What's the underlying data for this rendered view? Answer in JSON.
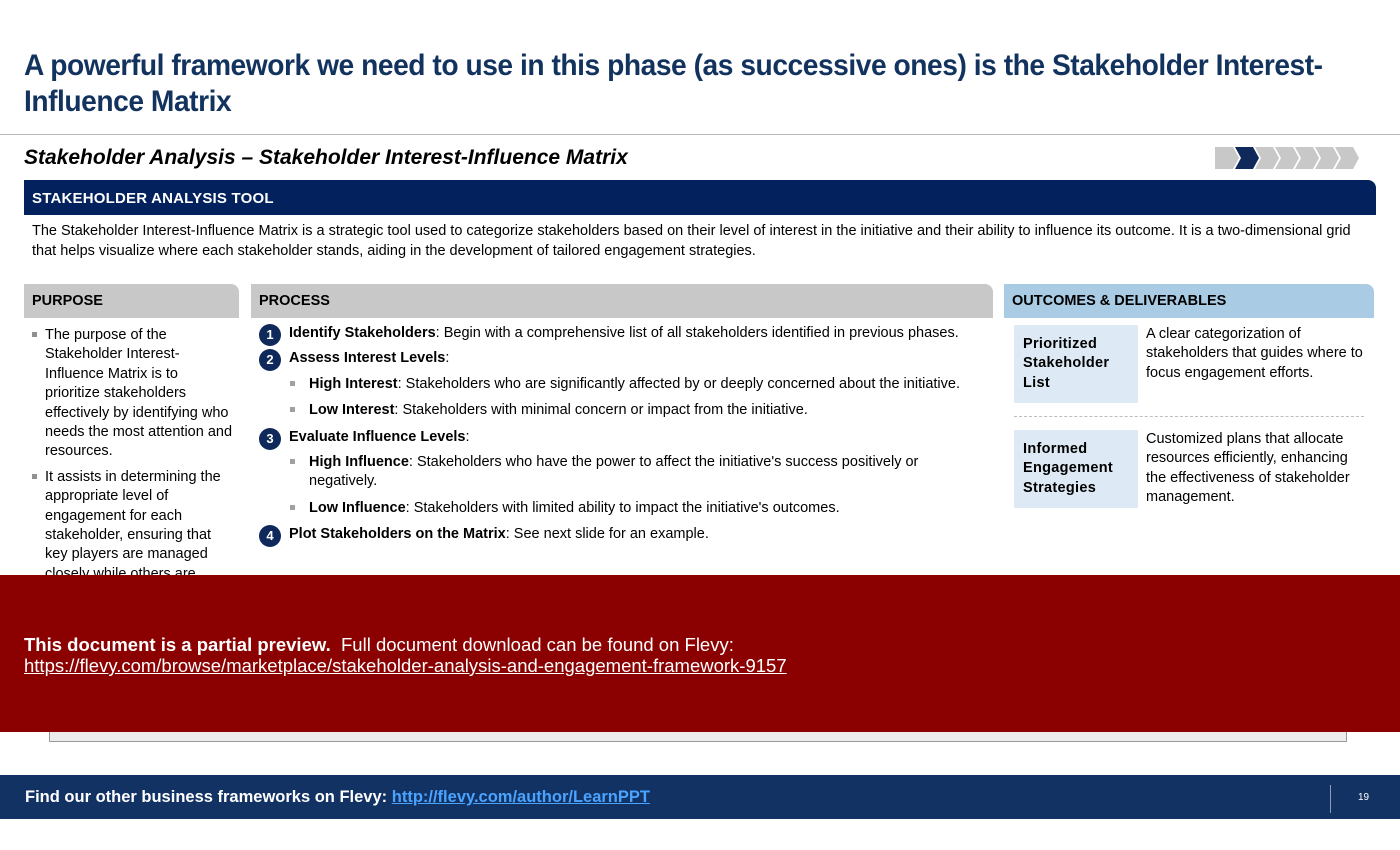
{
  "slide": {
    "title": "A powerful framework we need to use in this phase (as successive ones) is the Stakeholder Interest-Influence Matrix",
    "subtitle": "Stakeholder Analysis – Stakeholder Interest-Influence Matrix",
    "progress": {
      "total_steps": 7,
      "active_step": 2
    }
  },
  "tool": {
    "header": "STAKEHOLDER ANALYSIS TOOL",
    "description": "The Stakeholder Interest-Influence Matrix is a strategic tool used to categorize stakeholders based on their level of interest in the initiative and their ability to influence its outcome. It is a two-dimensional grid that helps visualize where each stakeholder stands, aiding in the development of tailored engagement strategies."
  },
  "purpose": {
    "header": "PURPOSE",
    "items": [
      "The purpose of the Stakeholder Interest-Influence Matrix is to prioritize stakeholders effectively by identifying who needs the most attention and resources.",
      "It assists in determining the appropriate level of engagement for each stakeholder, ensuring that key players are managed closely while others are"
    ]
  },
  "process": {
    "header": "PROCESS",
    "steps": [
      {
        "num": "1",
        "title": "Identify Stakeholders",
        "text": ": Begin with a comprehensive list of all stakeholders identified in previous phases.",
        "subs": []
      },
      {
        "num": "2",
        "title": "Assess Interest Levels",
        "text": ":",
        "subs": [
          {
            "title": "High Interest",
            "text": ": Stakeholders who are significantly affected by or deeply concerned about the initiative."
          },
          {
            "title": "Low Interest",
            "text": ": Stakeholders with minimal concern or impact from the initiative."
          }
        ]
      },
      {
        "num": "3",
        "title": "Evaluate Influence Levels",
        "text": ":",
        "subs": [
          {
            "title": "High Influence",
            "text": ": Stakeholders who have the power to affect the initiative's success positively or negatively."
          },
          {
            "title": "Low Influence",
            "text": ": Stakeholders with limited ability to impact the initiative's outcomes."
          }
        ]
      },
      {
        "num": "4",
        "title": "Plot Stakeholders on the Matrix",
        "text": ": See next slide for an example.",
        "subs": []
      }
    ]
  },
  "outcomes": {
    "header": "OUTCOMES & DELIVERABLES",
    "items": [
      {
        "label": "Prioritized Stakeholder List",
        "text": "A clear categorization of stakeholders that guides where to focus engagement efforts."
      },
      {
        "label": "Informed Engagement Strategies",
        "text": "Customized plans that allocate resources efficiently, enhancing the effectiveness of stakeholder management."
      }
    ]
  },
  "preview": {
    "bold": "This document is a partial preview.",
    "text": "Full document download can be found on Flevy:",
    "link": "https://flevy.com/browse/marketplace/stakeholder-analysis-and-engagement-framework-9157"
  },
  "footer": {
    "text": "Find our other business frameworks on Flevy:",
    "link": "http://flevy.com/author/LearnPPT",
    "page_number": "19"
  },
  "colors": {
    "title": "#13335f",
    "navy_bar": "#03215c",
    "grey_header": "#c8c8c8",
    "blue_header": "#a9cbe3",
    "outcome_label_bg": "#dde9f4",
    "preview_banner": "#8b0000",
    "footer_bg": "#123263",
    "footer_link": "#4aa3ff"
  }
}
